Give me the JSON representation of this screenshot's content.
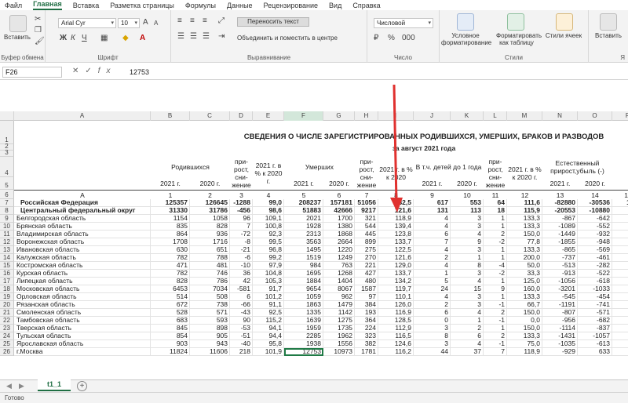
{
  "menu": [
    "Файл",
    "Главная",
    "Вставка",
    "Разметка страницы",
    "Формулы",
    "Данные",
    "Рецензирование",
    "Вид",
    "Справка"
  ],
  "menu_active": 1,
  "ribbon": {
    "clipboard": {
      "paste": "Вставить",
      "label": "Буфер обмена"
    },
    "font": {
      "name": "Arial Cyr",
      "size": "10",
      "label": "Шрифт"
    },
    "alignment": {
      "wrap": "Переносить текст",
      "merge": "Объединить и поместить в центре",
      "label": "Выравнивание"
    },
    "number": {
      "format": "Числовой",
      "label": "Число"
    },
    "styles": {
      "cond": "Условное форматирование",
      "table": "Форматировать как таблицу",
      "cell": "Стили ячеек",
      "label": "Стили"
    },
    "cells": {
      "insert": "Вставить",
      "label": "Я"
    }
  },
  "formula_bar": {
    "name_box": "F26",
    "value": "12753"
  },
  "columns": [
    "A",
    "B",
    "C",
    "D",
    "E",
    "F",
    "G",
    "H",
    "I",
    "J",
    "K",
    "L",
    "M",
    "N",
    "O",
    "P"
  ],
  "title": "СВЕДЕНИЯ О ЧИСЛЕ ЗАРЕГИСТРИРОВАННЫХ  РОДИВШИХСЯ, УМЕРШИХ, БРАКОВ И РАЗВОДОВ",
  "subtitle": "за август 2021 года",
  "headers": {
    "born": "Родившихся",
    "inc1": "при-рост, сни-жение",
    "pct1": "2021 г. в % к 2020 г.",
    "died": "Умерших",
    "inc2": "при-рост, сни-жение",
    "pct2": "2021 г. в % к 2020",
    "children": "В т.ч. детей до 1 года",
    "inc3": "при-рост, сни-жение",
    "pct3": "2021 г. в % к 2020 г.",
    "natural": "Естественный прирост,убыль (-)",
    "y2021": "2021 г.",
    "y2020": "2020 г."
  },
  "colnums": [
    "А",
    "1",
    "2",
    "3",
    "4",
    "5",
    "6",
    "7",
    "8",
    "9",
    "10",
    "11",
    "12",
    "13",
    "14",
    "15"
  ],
  "rows": [
    {
      "n": 7,
      "bold": true,
      "cells": [
        "Российская Федерация",
        "125357",
        "126645",
        "-1288",
        "99,0",
        "208237",
        "157181",
        "51056",
        "132,5",
        "617",
        "553",
        "64",
        "111,6",
        "-82880",
        "-30536",
        "1209"
      ]
    },
    {
      "n": 8,
      "bold": true,
      "cells": [
        "Центральный федеральный округ",
        "31330",
        "31786",
        "-456",
        "98,6",
        "51883",
        "42666",
        "9217",
        "121,6",
        "131",
        "113",
        "18",
        "115,9",
        "-20553",
        "-10880",
        "354"
      ]
    },
    {
      "n": 9,
      "cells": [
        "Белгородская область",
        "1154",
        "1058",
        "96",
        "109,1",
        "2021",
        "1700",
        "321",
        "118,9",
        "4",
        "3",
        "1",
        "133,3",
        "-867",
        "-642",
        "1"
      ]
    },
    {
      "n": 10,
      "cells": [
        "Брянская область",
        "835",
        "828",
        "7",
        "100,8",
        "1928",
        "1380",
        "544",
        "139,4",
        "4",
        "3",
        "1",
        "133,3",
        "-1089",
        "-552",
        "1"
      ]
    },
    {
      "n": 11,
      "cells": [
        "Владимирская область",
        "864",
        "936",
        "-72",
        "92,3",
        "2313",
        "1868",
        "445",
        "123,8",
        "6",
        "4",
        "2",
        "150,0",
        "-1449",
        "-932",
        "1"
      ]
    },
    {
      "n": 12,
      "cells": [
        "Воронежская область",
        "1708",
        "1716",
        "-8",
        "99,5",
        "3563",
        "2664",
        "899",
        "133,7",
        "7",
        "9",
        "-2",
        "77,8",
        "-1855",
        "-948",
        "2"
      ]
    },
    {
      "n": 13,
      "cells": [
        "Ивановская область",
        "630",
        "651",
        "-21",
        "96,8",
        "1495",
        "1220",
        "275",
        "122,5",
        "4",
        "3",
        "1",
        "133,3",
        "-865",
        "-569",
        ""
      ]
    },
    {
      "n": 14,
      "cells": [
        "Калужская область",
        "782",
        "788",
        "-6",
        "99,2",
        "1519",
        "1249",
        "270",
        "121,6",
        "2",
        "1",
        "1",
        "200,0",
        "-737",
        "-461",
        ""
      ]
    },
    {
      "n": 15,
      "cells": [
        "Костромская область",
        "471",
        "481",
        "-10",
        "97,9",
        "984",
        "763",
        "221",
        "129,0",
        "4",
        "8",
        "-4",
        "50,0",
        "-513",
        "-282",
        ""
      ]
    },
    {
      "n": 16,
      "cells": [
        "Курская область",
        "782",
        "746",
        "36",
        "104,8",
        "1695",
        "1268",
        "427",
        "133,7",
        "1",
        "3",
        "-2",
        "33,3",
        "-913",
        "-522",
        ""
      ]
    },
    {
      "n": 17,
      "cells": [
        "Липецкая область",
        "828",
        "786",
        "42",
        "105,3",
        "1884",
        "1404",
        "480",
        "134,2",
        "5",
        "4",
        "1",
        "125,0",
        "-1056",
        "-618",
        ""
      ]
    },
    {
      "n": 18,
      "cells": [
        "Московская область",
        "6453",
        "7034",
        "-581",
        "91,7",
        "9654",
        "8067",
        "1587",
        "119,7",
        "24",
        "15",
        "9",
        "160,0",
        "-3201",
        "-1033",
        "7"
      ]
    },
    {
      "n": 19,
      "cells": [
        "Орловская область",
        "514",
        "508",
        "6",
        "101,2",
        "1059",
        "962",
        "97",
        "110,1",
        "4",
        "3",
        "1",
        "133,3",
        "-545",
        "-454",
        ""
      ]
    },
    {
      "n": 20,
      "cells": [
        "Рязанская область",
        "672",
        "738",
        "-66",
        "91,1",
        "1863",
        "1479",
        "384",
        "126,0",
        "2",
        "3",
        "-1",
        "66,7",
        "-1191",
        "-741",
        ""
      ]
    },
    {
      "n": 21,
      "cells": [
        "Смоленская область",
        "528",
        "571",
        "-43",
        "92,5",
        "1335",
        "1142",
        "193",
        "116,9",
        "6",
        "4",
        "2",
        "150,0",
        "-807",
        "-571",
        ""
      ]
    },
    {
      "n": 22,
      "cells": [
        "Тамбовская область",
        "683",
        "593",
        "90",
        "115,2",
        "1639",
        "1275",
        "364",
        "128,5",
        "0",
        "1",
        "-1",
        "0,0",
        "-956",
        "-682",
        ""
      ]
    },
    {
      "n": 23,
      "cells": [
        "Тверская область",
        "845",
        "898",
        "-53",
        "94,1",
        "1959",
        "1735",
        "224",
        "112,9",
        "3",
        "2",
        "1",
        "150,0",
        "-1114",
        "-837",
        ""
      ]
    },
    {
      "n": 24,
      "cells": [
        "Тульская область",
        "854",
        "905",
        "-51",
        "94,4",
        "2285",
        "1962",
        "323",
        "116,5",
        "8",
        "6",
        "2",
        "133,3",
        "-1431",
        "-1057",
        "1"
      ]
    },
    {
      "n": 25,
      "cells": [
        "Ярославская область",
        "903",
        "943",
        "-40",
        "95,8",
        "1938",
        "1556",
        "382",
        "124,6",
        "3",
        "4",
        "-1",
        "75,0",
        "-1035",
        "-613",
        "1"
      ]
    },
    {
      "n": 26,
      "cells": [
        "г.Москва",
        "11824",
        "11606",
        "218",
        "101,9",
        "12753",
        "10973",
        "1781",
        "116,2",
        "44",
        "37",
        "7",
        "118,9",
        "-929",
        "633",
        "2"
      ]
    }
  ],
  "sheet_tab": "t1_1",
  "status": "Готово"
}
